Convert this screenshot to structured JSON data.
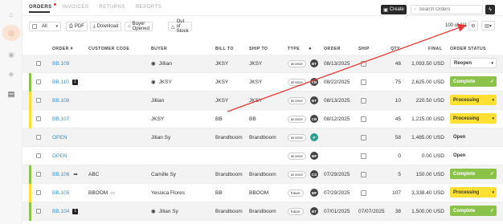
{
  "tabs": [
    {
      "label": "ORDERS",
      "active": true
    },
    {
      "label": "INVOICES",
      "active": false
    },
    {
      "label": "RETURNS",
      "active": false
    },
    {
      "label": "REPORTS",
      "active": false
    }
  ],
  "header": {
    "create_label": "Create",
    "search_placeholder": "Search Orders"
  },
  "toolbar": {
    "all_label": "All",
    "pdf_label": "PDF",
    "download_label": "Download",
    "buyer_opened_label": "Buyer Opened",
    "out_of_stock_label": "Out of Stock",
    "count_text": "100 of 111"
  },
  "columns": [
    "ORDER #",
    "CUSTOMER CODE",
    "BUYER",
    "BILL TO",
    "SHIP TO",
    "TYPE",
    "ORDER",
    "SHIP",
    "QTY",
    "FINAL",
    "ORDER STATUS"
  ],
  "rows": [
    {
      "order": "BB.109",
      "badge": "",
      "code": "",
      "buyer": "Jillian",
      "eye": true,
      "bill": "JKSY",
      "ship_to": "JKSY",
      "type": "at once",
      "avatar": "BT",
      "order_date": "08/13/2025",
      "ship_date": "",
      "qty": "48",
      "final": "1,093.50 USD",
      "status": "Reopen",
      "status_kind": "plain",
      "bar": "",
      "shade": true
    },
    {
      "order": "BB.110",
      "badge": "1",
      "code": "",
      "buyer": "JKSY",
      "eye": true,
      "bill": "JKSY",
      "ship_to": "JKSY",
      "type": "at once",
      "avatar": "CB",
      "order_date": "08/22/2025",
      "ship_date": "",
      "qty": "75",
      "final": "2,625.00 USD",
      "status": "Complete",
      "status_kind": "complete",
      "bar": "#8bc34a",
      "shade": false
    },
    {
      "order": "BB.108",
      "badge": "",
      "code": "",
      "buyer": "Jillian",
      "eye": false,
      "bill": "JKSY",
      "ship_to": "JKSY",
      "type": "at once",
      "avatar": "BT",
      "order_date": "08/13/2025",
      "ship_date": "",
      "qty": "10",
      "final": "220.50 USD",
      "status": "Processing",
      "status_kind": "processing",
      "bar": "#ffe033",
      "shade": true
    },
    {
      "order": "BB.107",
      "badge": "",
      "code": "",
      "buyer": "JKSY",
      "eye": false,
      "bill": "BB",
      "ship_to": "BB",
      "type": "at once",
      "avatar": "CB",
      "order_date": "08/12/2025",
      "ship_date": "",
      "qty": "45",
      "final": "1,215.00 USD",
      "status": "Processing",
      "status_kind": "processing",
      "bar": "#ffe033",
      "shade": false
    },
    {
      "order": "OPEN",
      "badge": "",
      "code": "",
      "buyer": "Jilian Sy",
      "eye": false,
      "bill": "Brandboom",
      "ship_to": "Brandboom",
      "type": "at once",
      "avatar": "P",
      "avatar_teal": true,
      "order_date": "",
      "ship_date": "",
      "qty": "58",
      "final": "1,485.00 USD",
      "status": "Open",
      "status_kind": "none",
      "bar": "",
      "shade": true
    },
    {
      "order": "OPEN",
      "badge": "",
      "code": "",
      "buyer": "",
      "eye": false,
      "bill": "",
      "ship_to": "",
      "type": "at once",
      "avatar": "MF",
      "order_date": "",
      "ship_date": "",
      "qty": "0",
      "final": "0.00 USD",
      "status": "Open",
      "status_kind": "none",
      "bar": "",
      "shade": false
    },
    {
      "order": "BB.106",
      "badge": "",
      "share": true,
      "code": "ABC",
      "buyer": "Camille Sy",
      "eye": false,
      "bill": "Brandboom",
      "ship_to": "Brandboom",
      "type": "at once",
      "avatar": "CS",
      "order_date": "07/29/2025",
      "ship_date": "",
      "qty": "5",
      "final": "150.00 USD",
      "status": "Complete",
      "status_kind": "complete",
      "bar": "#8bc34a",
      "shade": true
    },
    {
      "order": "BB.105",
      "badge": "",
      "code": "BBOOM",
      "code_icon": true,
      "buyer": "Yessica Flores",
      "eye": false,
      "bill": "BB",
      "ship_to": "BBOOM",
      "type": "future",
      "avatar": "MF",
      "order_date": "07/29/2025",
      "ship_date": "",
      "qty": "107",
      "final": "3,338.40 USD",
      "status": "Processing",
      "status_kind": "processing",
      "bar": "#ffe033",
      "shade": false
    },
    {
      "order": "BB.104",
      "badge": "1",
      "code": "",
      "buyer": "Jilian Sy",
      "eye": true,
      "bill": "Brandboom",
      "ship_to": "Brandboom",
      "type": "future",
      "avatar": "BT",
      "order_date": "07/01/2025",
      "ship_date": "07/07/2025",
      "qty": "38",
      "final": "1,500.00 USD",
      "status": "Complete",
      "status_kind": "complete",
      "bar": "#8bc34a",
      "shade": true
    }
  ],
  "colors": {
    "accent": "#3a8fc9",
    "complete": "#8bc34a",
    "processing": "#ffe033",
    "annotation_arrow": "#e53935"
  }
}
